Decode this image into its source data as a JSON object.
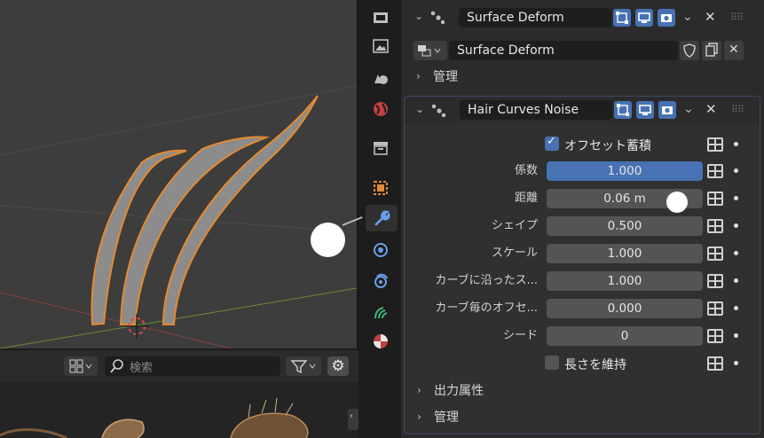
{
  "colors": {
    "accent": "#4772b3",
    "hair_outline": "#e58a2e",
    "hair_fill": "#8c8c8c"
  },
  "modifier1": {
    "name": "Surface Deform",
    "surface_field": "Surface Deform",
    "manage_label": "管理"
  },
  "modifier2": {
    "name": "Hair Curves Noise",
    "offset_accumulate": {
      "label": "オフセット蓄積",
      "checked": true
    },
    "rows": [
      {
        "label": "係数",
        "value": "1.000"
      },
      {
        "label": "距離",
        "value": "0.06 m"
      },
      {
        "label": "シェイプ",
        "value": "0.500"
      },
      {
        "label": "スケール",
        "value": "1.000"
      },
      {
        "label": "カーブに沿ったス...",
        "value": "1.000"
      },
      {
        "label": "カーブ毎のオフセ...",
        "value": "0.000"
      },
      {
        "label": "シード",
        "value": "0"
      }
    ],
    "keep_length": {
      "label": "長さを維持",
      "checked": false
    },
    "output_attributes_label": "出力属性",
    "manage_label": "管理"
  },
  "asset_browser": {
    "search_placeholder": "検索"
  },
  "tabs": [
    "tool-tab",
    "render-tab",
    "output-tab",
    "view-layer-tab",
    "scene-tab",
    "world-tab",
    "collection-tab",
    "object-tab",
    "modifier-tab",
    "particles-tab",
    "physics-tab",
    "object-data-tab",
    "material-tab"
  ],
  "active_tab": "modifier-tab"
}
